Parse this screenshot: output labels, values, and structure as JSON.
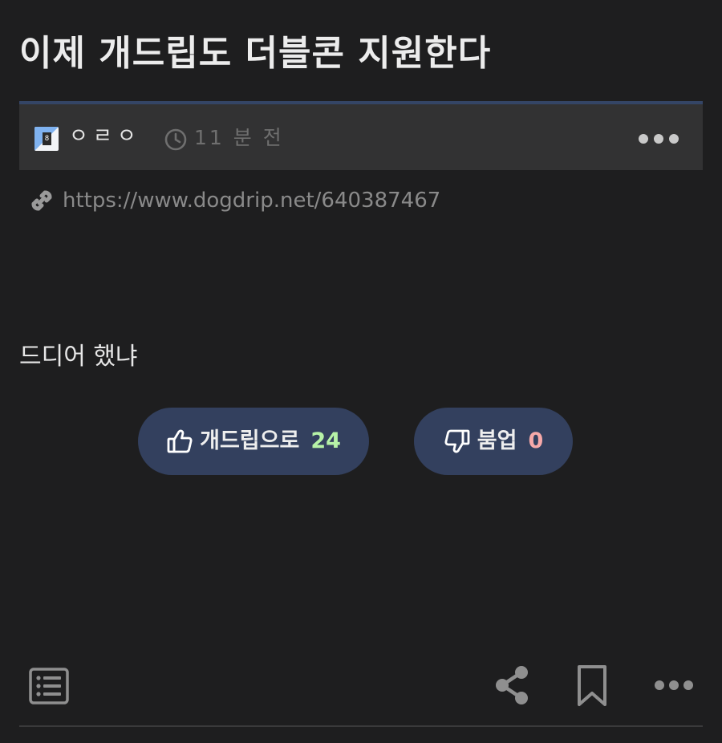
{
  "post": {
    "title": "이제 개드립도 더블콘 지원한다",
    "body": "드디어 했냐",
    "url": "https://www.dogdrip.net/640387467"
  },
  "meta": {
    "author": "ㅇㄹㅇ",
    "level_badge": "8",
    "time_ago": "11 분 전",
    "icons": {
      "clock": "clock-icon",
      "more": "more-horizontal-icon",
      "link": "link-icon"
    }
  },
  "votes": {
    "up": {
      "label": "개드립으로",
      "count": "24",
      "icon": "thumbs-up-icon",
      "count_color": "#b6f2a7"
    },
    "down": {
      "label": "붐업",
      "count": "0",
      "icon": "thumbs-down-icon",
      "count_color": "#f7a9a9"
    }
  },
  "toolbar": {
    "icons": [
      "list-icon",
      "share-icon",
      "bookmark-icon",
      "more-horizontal-icon"
    ]
  },
  "colors": {
    "background": "#1e1e1f",
    "meta_bar": "#323233",
    "meta_accent": "#344566",
    "vote_button": "#33405e",
    "icon_gray": "#8f8f8f"
  }
}
